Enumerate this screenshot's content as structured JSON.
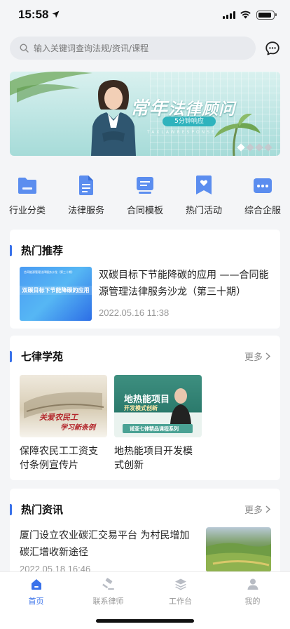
{
  "status": {
    "time": "15:58"
  },
  "search": {
    "placeholder": "输入关键词查询法规/资讯/课程"
  },
  "banner": {
    "title_part1": "常年",
    "title_part2": "法律顾问",
    "pill": "5分钟响应",
    "sub": "TAXLAWRESPONSE",
    "slides": 4,
    "active_slide": 1
  },
  "categories": [
    {
      "label": "行业分类",
      "icon": "folder-icon"
    },
    {
      "label": "法律服务",
      "icon": "document-icon"
    },
    {
      "label": "合同模板",
      "icon": "contract-template-icon"
    },
    {
      "label": "热门活动",
      "icon": "heart-bookmark-icon"
    },
    {
      "label": "综合企服",
      "icon": "more-services-icon"
    }
  ],
  "hot_recommend": {
    "title": "热门推荐",
    "item": {
      "thumb_text": "双碳目标下节能降碳的应用",
      "thumb_caption": "合同能源管理法律服务沙龙（第三十期）",
      "title": "双碳目标下节能降碳的应用 ——合同能源管理法律服务沙龙（第三十期）",
      "date": "2022.05.16 11:38"
    }
  },
  "academy": {
    "title": "七律学苑",
    "more": "更多",
    "courses": [
      {
        "title": "保障农民工工资支付条例宣传片",
        "img_text1": "关爱农民工",
        "img_text2": "学习新条例"
      },
      {
        "title": "地热能项目开发模式创新",
        "img_text1": "地热能项目",
        "img_text2": "开发模式创新",
        "img_text3": "诺亚七律精品课程系列"
      }
    ]
  },
  "hot_news": {
    "title": "热门资讯",
    "more": "更多",
    "item": {
      "title": "厦门设立农业碳汇交易平台 为村民增加碳汇增收新途径",
      "date": "2022.05.18 16:46"
    }
  },
  "tabs": [
    {
      "label": "首页",
      "icon": "home-icon",
      "active": true
    },
    {
      "label": "联系律师",
      "icon": "gavel-icon",
      "active": false
    },
    {
      "label": "工作台",
      "icon": "layers-icon",
      "active": false
    },
    {
      "label": "我的",
      "icon": "user-icon",
      "active": false
    }
  ],
  "colors": {
    "accent": "#3a72ea",
    "icon_blue": "#5b8def",
    "background": "#f4f5f7"
  }
}
